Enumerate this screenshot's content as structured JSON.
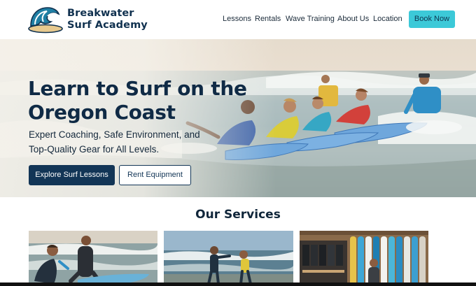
{
  "header": {
    "brand_line1": "Breakwater",
    "brand_line2": "Surf Academy",
    "nav": [
      {
        "label": "Lessons"
      },
      {
        "label": "Rentals"
      },
      {
        "label": "Wave Training"
      },
      {
        "label": "About Us"
      },
      {
        "label": "Location"
      }
    ],
    "cta_label": "Book Now"
  },
  "hero": {
    "title": "Learn to Surf on the Oregon Coast",
    "subtitle": "Expert Coaching, Safe Environment, and Top-Quality Gear for All Levels.",
    "primary_button": "Explore Surf Lessons",
    "secondary_button": "Rent Equipment"
  },
  "services": {
    "title": "Our Services",
    "cards": [
      {
        "icon": "surf-lesson-photo"
      },
      {
        "icon": "wave-training-photo"
      },
      {
        "icon": "rental-shop-photo"
      }
    ]
  },
  "colors": {
    "brand_navy": "#123556",
    "accent_teal": "#3cc9d8",
    "text_dark": "#10263a"
  }
}
